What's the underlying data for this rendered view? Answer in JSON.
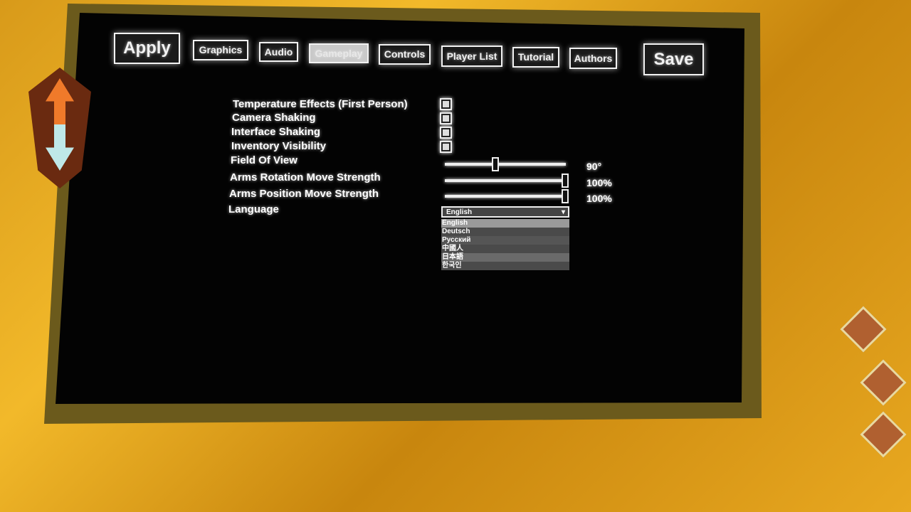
{
  "tabs": {
    "apply": "Apply",
    "graphics": "Graphics",
    "audio": "Audio",
    "gameplay": "Gameplay",
    "controls": "Controls",
    "player_list": "Player List",
    "tutorial": "Tutorial",
    "authors": "Authors",
    "save": "Save",
    "active": "Gameplay"
  },
  "settings": {
    "temperature_effects": {
      "label": "Temperature Effects (First Person)",
      "checked": true
    },
    "camera_shaking": {
      "label": "Camera Shaking",
      "checked": true
    },
    "interface_shaking": {
      "label": "Interface Shaking",
      "checked": true
    },
    "inventory_visibility": {
      "label": "Inventory Visibility",
      "checked": true
    },
    "field_of_view": {
      "label": "Field Of View",
      "value": "90°",
      "fraction": 0.4
    },
    "arms_rotation": {
      "label": "Arms Rotation Move Strength",
      "value": "100%",
      "fraction": 1.0
    },
    "arms_position": {
      "label": "Arms Position Move Strength",
      "value": "100%",
      "fraction": 1.0
    },
    "language": {
      "label": "Language",
      "selected": "English",
      "options": [
        "English",
        "Deutsch",
        "Русский",
        "中國人",
        "日本語",
        "한국인"
      ]
    }
  }
}
